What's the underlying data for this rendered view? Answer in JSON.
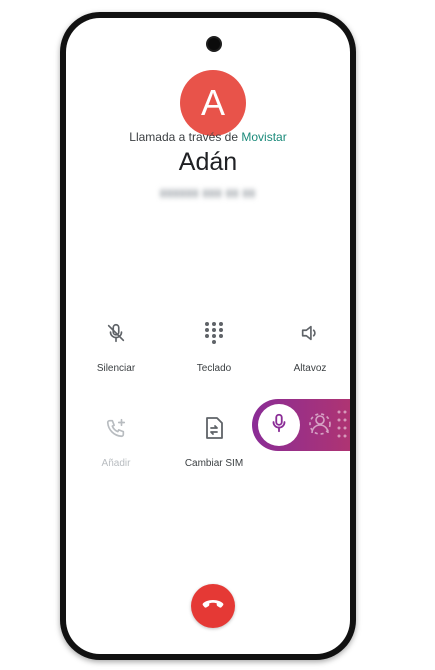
{
  "contact": {
    "initial": "A",
    "via_prefix": "Llamada a través de",
    "carrier": "Movistar",
    "name": "Adán"
  },
  "controls": {
    "mute_label": "Silenciar",
    "keypad_label": "Teclado",
    "speaker_label": "Altavoz",
    "add_label": "Añadir",
    "sim_label": "Cambiar SIM"
  },
  "icons": {
    "mute": "mic-off-icon",
    "keypad": "dialpad-icon",
    "speaker": "volume-icon",
    "add": "add-call-icon",
    "sim": "sim-swap-icon",
    "overlay_mic": "microphone-icon",
    "end": "hang-up-icon"
  },
  "colors": {
    "avatar": "#e8534a",
    "carrier": "#1a8a7a",
    "end_call": "#e53935",
    "overlay_start": "#8a2c96",
    "overlay_end": "#b3356e"
  }
}
